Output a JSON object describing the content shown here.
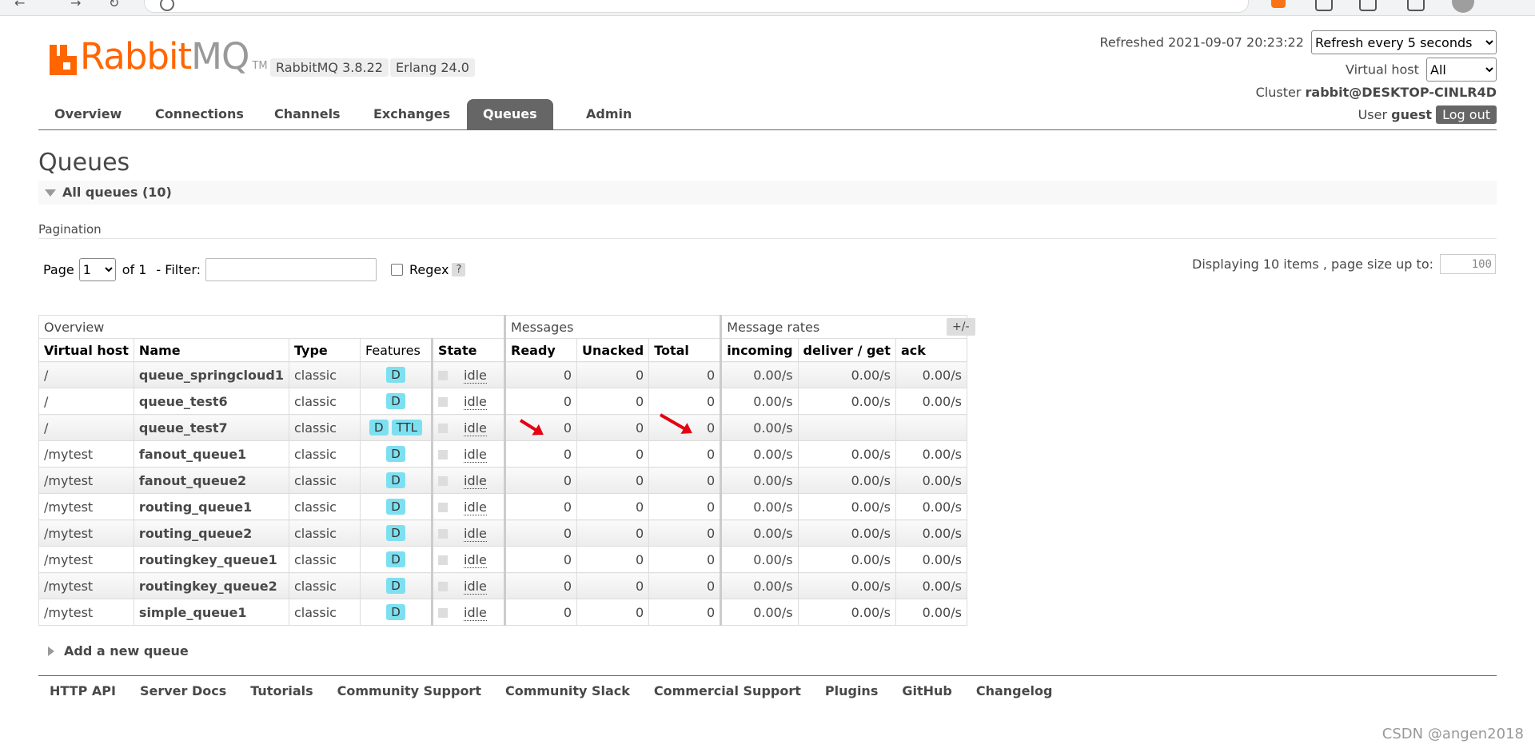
{
  "header": {
    "logo_word": "Rabbit",
    "logo_word2": "MQ",
    "logo_tm": "TM",
    "version_badge": "RabbitMQ 3.8.22",
    "erlang_badge": "Erlang 24.0",
    "refreshed_label": "Refreshed 2021-09-07 20:23:22",
    "refresh_select": "Refresh every 5 seconds",
    "vhost_label": "Virtual host",
    "vhost_select": "All",
    "cluster_label": "Cluster",
    "cluster_value": "rabbit@DESKTOP-CINLR4D",
    "user_label": "User",
    "user_value": "guest",
    "logout_label": "Log out"
  },
  "tabs": [
    "Overview",
    "Connections",
    "Channels",
    "Exchanges",
    "Queues",
    "Admin"
  ],
  "active_tab": "Queues",
  "page_title": "Queues",
  "section_title": "All queues (10)",
  "pagination": {
    "label": "Pagination",
    "page_label": "Page",
    "page_value": "1",
    "of_label": "of 1",
    "filter_label": "- Filter:",
    "regex_label": "Regex",
    "help_label": "?",
    "display_text": "Displaying 10 items , page size up to:",
    "page_size": "100"
  },
  "table": {
    "groups": [
      "Overview",
      "Messages",
      "Message rates"
    ],
    "columns": [
      "Virtual host",
      "Name",
      "Type",
      "Features",
      "State",
      "Ready",
      "Unacked",
      "Total",
      "incoming",
      "deliver / get",
      "ack"
    ],
    "toggle_label": "+/-",
    "rows": [
      {
        "vhost": "/",
        "name": "queue_springcloud1",
        "type": "classic",
        "features": [
          "D"
        ],
        "state": "idle",
        "ready": "0",
        "unacked": "0",
        "total": "0",
        "incoming": "0.00/s",
        "deliver": "0.00/s",
        "ack": "0.00/s"
      },
      {
        "vhost": "/",
        "name": "queue_test6",
        "type": "classic",
        "features": [
          "D"
        ],
        "state": "idle",
        "ready": "0",
        "unacked": "0",
        "total": "0",
        "incoming": "0.00/s",
        "deliver": "0.00/s",
        "ack": "0.00/s"
      },
      {
        "vhost": "/",
        "name": "queue_test7",
        "type": "classic",
        "features": [
          "D",
          "TTL"
        ],
        "state": "idle",
        "ready": "0",
        "unacked": "0",
        "total": "0",
        "incoming": "0.00/s",
        "deliver": "",
        "ack": ""
      },
      {
        "vhost": "/mytest",
        "name": "fanout_queue1",
        "type": "classic",
        "features": [
          "D"
        ],
        "state": "idle",
        "ready": "0",
        "unacked": "0",
        "total": "0",
        "incoming": "0.00/s",
        "deliver": "0.00/s",
        "ack": "0.00/s"
      },
      {
        "vhost": "/mytest",
        "name": "fanout_queue2",
        "type": "classic",
        "features": [
          "D"
        ],
        "state": "idle",
        "ready": "0",
        "unacked": "0",
        "total": "0",
        "incoming": "0.00/s",
        "deliver": "0.00/s",
        "ack": "0.00/s"
      },
      {
        "vhost": "/mytest",
        "name": "routing_queue1",
        "type": "classic",
        "features": [
          "D"
        ],
        "state": "idle",
        "ready": "0",
        "unacked": "0",
        "total": "0",
        "incoming": "0.00/s",
        "deliver": "0.00/s",
        "ack": "0.00/s"
      },
      {
        "vhost": "/mytest",
        "name": "routing_queue2",
        "type": "classic",
        "features": [
          "D"
        ],
        "state": "idle",
        "ready": "0",
        "unacked": "0",
        "total": "0",
        "incoming": "0.00/s",
        "deliver": "0.00/s",
        "ack": "0.00/s"
      },
      {
        "vhost": "/mytest",
        "name": "routingkey_queue1",
        "type": "classic",
        "features": [
          "D"
        ],
        "state": "idle",
        "ready": "0",
        "unacked": "0",
        "total": "0",
        "incoming": "0.00/s",
        "deliver": "0.00/s",
        "ack": "0.00/s"
      },
      {
        "vhost": "/mytest",
        "name": "routingkey_queue2",
        "type": "classic",
        "features": [
          "D"
        ],
        "state": "idle",
        "ready": "0",
        "unacked": "0",
        "total": "0",
        "incoming": "0.00/s",
        "deliver": "0.00/s",
        "ack": "0.00/s"
      },
      {
        "vhost": "/mytest",
        "name": "simple_queue1",
        "type": "classic",
        "features": [
          "D"
        ],
        "state": "idle",
        "ready": "0",
        "unacked": "0",
        "total": "0",
        "incoming": "0.00/s",
        "deliver": "0.00/s",
        "ack": "0.00/s"
      }
    ]
  },
  "add_queue_label": "Add a new queue",
  "footer_links": [
    "HTTP API",
    "Server Docs",
    "Tutorials",
    "Community Support",
    "Community Slack",
    "Commercial Support",
    "Plugins",
    "GitHub",
    "Changelog"
  ],
  "watermark": "CSDN @angen2018",
  "colors": {
    "brand": "#ff6600",
    "tab_active": "#666666",
    "feature_badge": "#7de0f0",
    "annotation_arrow": "#e60012"
  }
}
